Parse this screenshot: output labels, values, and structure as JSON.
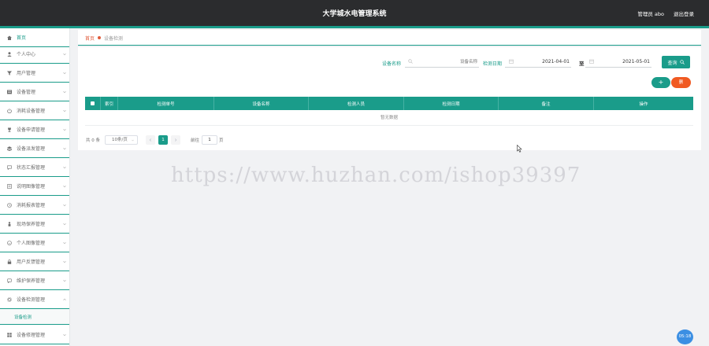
{
  "header": {
    "title": "大学城水电管理系统",
    "admin_label": "管理员 abo",
    "logout": "退出登录"
  },
  "sidebar": {
    "items": [
      {
        "label": "首页",
        "icon": "home-icon"
      },
      {
        "label": "个人中心",
        "icon": "user-icon"
      },
      {
        "label": "用户管理",
        "icon": "funnel-icon"
      },
      {
        "label": "设备管理",
        "icon": "list-icon"
      },
      {
        "label": "消耗设备管理",
        "icon": "power-icon"
      },
      {
        "label": "设备申请管理",
        "icon": "trophy-icon"
      },
      {
        "label": "设备派发管理",
        "icon": "stack-icon"
      },
      {
        "label": "状态汇报管理",
        "icon": "chat-icon"
      },
      {
        "label": "说明图像管理",
        "icon": "doc-icon"
      },
      {
        "label": "消耗报表管理",
        "icon": "clock-icon"
      },
      {
        "label": "现场保养管理",
        "icon": "person-icon"
      },
      {
        "label": "个人图像管理",
        "icon": "smile-icon"
      },
      {
        "label": "用户反馈管理",
        "icon": "lock-icon"
      },
      {
        "label": "维护保养管理",
        "icon": "message-icon"
      },
      {
        "label": "设备检测管理",
        "icon": "gear-icon"
      },
      {
        "label": "设备修理管理",
        "icon": "grid-icon"
      }
    ],
    "sub_item": "设备检测"
  },
  "breadcrumb": {
    "home": "首页",
    "current": "设备检测"
  },
  "search": {
    "name_label": "设备名称",
    "name_placeholder": "设备名称",
    "date_label": "检测日期",
    "date_from": "2021-04-01",
    "to": "至",
    "date_to": "2021-05-01",
    "query_button": "查询"
  },
  "actions": {
    "add": "+",
    "delete": "删"
  },
  "table": {
    "columns": [
      "索引",
      "检测单号",
      "设备名称",
      "检测人员",
      "检测日期",
      "备注",
      "操作"
    ],
    "empty_text": "暂无数据"
  },
  "pagination": {
    "total": "共 0 条",
    "page_size": "10条/页",
    "current_page": "1",
    "goto_label": "前往",
    "jump_value": "1",
    "page_suffix": "页"
  },
  "watermark": "https://www.huzhan.com/ishop39397",
  "badge": "05:18",
  "colors": {
    "accent": "#1a9c8a",
    "danger": "#f05a22",
    "topbar": "#2b2c2e",
    "badge": "#3b8fe3"
  }
}
